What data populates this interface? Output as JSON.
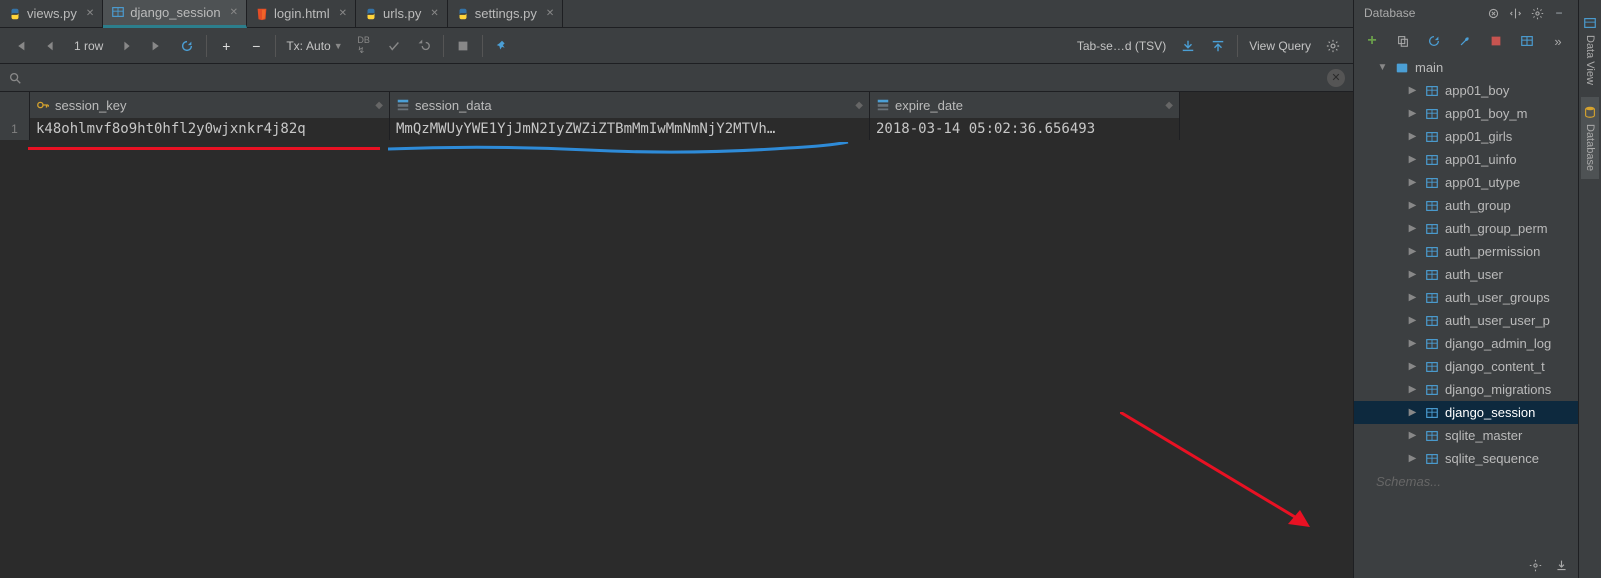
{
  "tabs": [
    {
      "label": "views.py",
      "icon": "py",
      "active": false
    },
    {
      "label": "django_session",
      "icon": "table",
      "active": true
    },
    {
      "label": "login.html",
      "icon": "html",
      "active": false
    },
    {
      "label": "urls.py",
      "icon": "py",
      "active": false
    },
    {
      "label": "settings.py",
      "icon": "py",
      "active": false
    }
  ],
  "toolbar": {
    "row_count": "1 row",
    "tx_label": "Tx:",
    "tx_mode": "Auto",
    "export_label": "Tab-se…d (TSV)",
    "view_query": "View Query"
  },
  "grid": {
    "columns": [
      {
        "name": "session_key"
      },
      {
        "name": "session_data"
      },
      {
        "name": "expire_date"
      }
    ],
    "rows": [
      {
        "num": "1",
        "session_key": "k48ohlmvf8o9ht0hfl2y0wjxnkr4j82q",
        "session_data": "MmQzMWUyYWE1YjJmN2IyZWZiZTBmMmIwMmNmNjY2MTVh…",
        "expire_date": "2018-03-14 05:02:36.656493"
      }
    ]
  },
  "database_panel": {
    "title": "Database",
    "root": "main",
    "tables": [
      "app01_boy",
      "app01_boy_m",
      "app01_girls",
      "app01_uinfo",
      "app01_utype",
      "auth_group",
      "auth_group_perm",
      "auth_permission",
      "auth_user",
      "auth_user_groups",
      "auth_user_user_p",
      "django_admin_log",
      "django_content_t",
      "django_migrations",
      "django_session",
      "sqlite_master",
      "sqlite_sequence"
    ],
    "selected": "django_session",
    "footer": "Schemas..."
  },
  "sidetabs": [
    {
      "label": "Data View",
      "active": false,
      "icon": "dataview"
    },
    {
      "label": "Database",
      "active": true,
      "icon": "db"
    }
  ]
}
